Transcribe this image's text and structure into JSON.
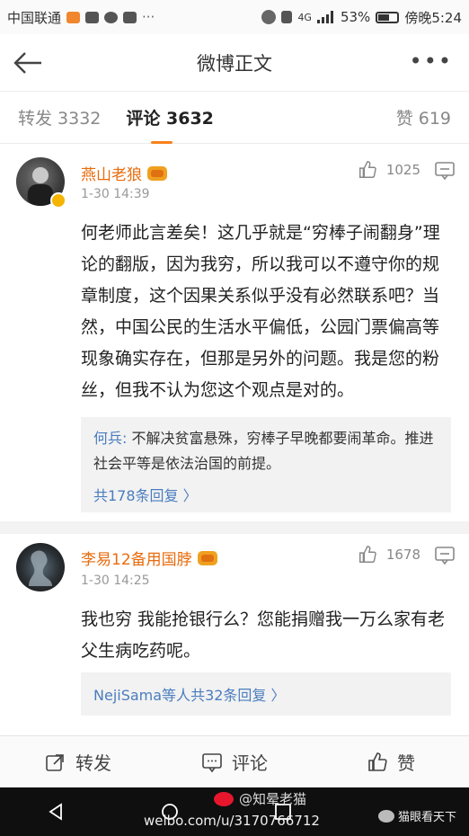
{
  "status_bar": {
    "carrier": "中国联通",
    "signal": "4G",
    "battery": "53%",
    "time": "傍晚5:24"
  },
  "header": {
    "title": "微博正文"
  },
  "tabs": [
    {
      "label": "转发 3332"
    },
    {
      "label": "评论 3632"
    },
    {
      "label": "赞 619"
    }
  ],
  "comments": [
    {
      "username": "燕山老狼",
      "time": "1-30 14:39",
      "likes": "1025",
      "text": "何老师此言差矣！这几乎就是“穷棒子闹翻身”理论的翻版，因为我穷，所以我可以不遵守你的规章制度，这个因果关系似乎没有必然联系吧？当然，中国公民的生活水平偏低，公园门票偏高等现象确实存在，但那是另外的问题。我是您的粉丝，但我不认为您这个观点是对的。",
      "reply": {
        "name": "何兵:",
        "text": " 不解决贫富悬殊，穷棒子早晚都要闹革命。推进社会平等是依法治国的前提。",
        "more": "共178条回复 〉"
      }
    },
    {
      "username": "李易12备用国脖",
      "time": "1-30 14:25",
      "likes": "1678",
      "text": "我也穷  我能抢银行么？您能捐赠我一万么家有老父生病吃药呢。",
      "reply": {
        "name": "NejiSama等人",
        "text": "",
        "more": " 共32条回复 〉"
      }
    }
  ],
  "actions": {
    "repost": "转发",
    "comment": "评论",
    "like": "赞"
  },
  "watermark": {
    "handle": "@知晕老猫",
    "url": "weibo.com/u/3170766712",
    "wechat": "猫眼看天下"
  },
  "colors": {
    "username": "#e86b0c",
    "link": "#4a7dbe",
    "tab_indicator": "#f7821b"
  }
}
